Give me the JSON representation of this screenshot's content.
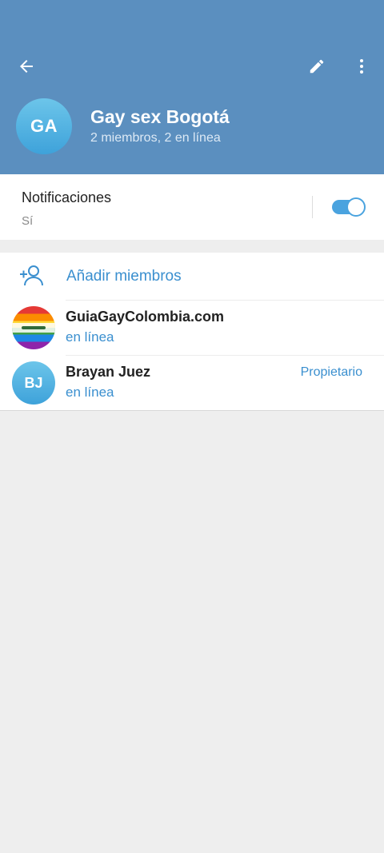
{
  "header": {
    "back_icon": "arrow-left-icon",
    "edit_icon": "pencil-icon",
    "more_icon": "more-vertical-icon",
    "avatar_initials": "GA",
    "title": "Gay sex Bogotá",
    "subtitle": "2 miembros, 2 en línea",
    "bg_color": "#5b8fbf"
  },
  "notifications": {
    "label": "Notificaciones",
    "value": "Sí",
    "enabled": true
  },
  "members": {
    "add_label": "Añadir miembros",
    "add_icon": "add-user-icon",
    "list": [
      {
        "name": "GuiaGayColombia.com",
        "status": "en línea",
        "role": "",
        "avatar": "rainbow-logo"
      },
      {
        "name": "Brayan Juez",
        "status": "en línea",
        "role": "Propietario",
        "initials": "BJ"
      }
    ]
  },
  "accent_color": "#3a8fcf"
}
